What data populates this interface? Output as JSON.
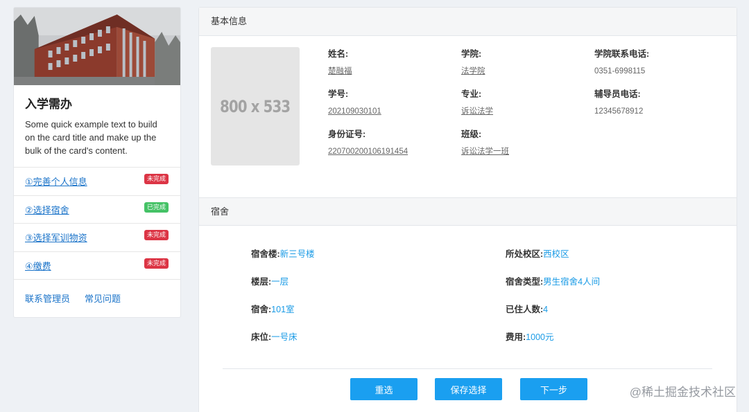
{
  "card": {
    "title": "入学需办",
    "text": "Some quick example text to build on the card title and make up the bulk of the card's content.",
    "steps": [
      {
        "label": "①完善个人信息",
        "status": "未完成",
        "status_color": "#dc3545"
      },
      {
        "label": "②选择宿舍",
        "status": "已完成",
        "status_color": "#45c266"
      },
      {
        "label": "③选择军训物资",
        "status": "未完成",
        "status_color": "#dc3545"
      },
      {
        "label": "④缴费",
        "status": "未完成",
        "status_color": "#dc3545"
      }
    ],
    "links": {
      "contact": "联系管理员",
      "faq": "常见问题"
    }
  },
  "basic": {
    "header": "基本信息",
    "photo_placeholder": "800 x 533",
    "name": {
      "label": "姓名:",
      "value": "楚融福"
    },
    "student_id": {
      "label": "学号:",
      "value": "202109030101"
    },
    "id_card": {
      "label": "身份证号:",
      "value": "220700200106191454"
    },
    "college": {
      "label": "学院:",
      "value": "法学院"
    },
    "major": {
      "label": "专业:",
      "value": "诉讼法学"
    },
    "class": {
      "label": "班级:",
      "value": "诉讼法学一班"
    },
    "college_phone": {
      "label": "学院联系电话:",
      "value": "0351-6998115"
    },
    "counselor_phone": {
      "label": "辅导员电话:",
      "value": "12345678912"
    }
  },
  "dorm": {
    "header": "宿舍",
    "building": {
      "label": "宿舍楼:",
      "value": "新三号楼"
    },
    "floor": {
      "label": "楼层:",
      "value": "一层"
    },
    "room": {
      "label": "宿舍:",
      "value": "101室"
    },
    "bed": {
      "label": "床位:",
      "value": "一号床"
    },
    "campus": {
      "label": "所处校区:",
      "value": "西校区"
    },
    "type": {
      "label": "宿舍类型:",
      "value": "男生宿舍4人间"
    },
    "occupants": {
      "label": "已住人数:",
      "value": "4"
    },
    "fee": {
      "label": "费用:",
      "value": "1000元"
    }
  },
  "buttons": {
    "reselect": "重选",
    "save": "保存选择",
    "next": "下一步"
  },
  "watermark": "@稀土掘金技术社区",
  "colors": {
    "accent": "#1a9ff0",
    "link": "#1a73c9",
    "value": "#1a9be6"
  }
}
